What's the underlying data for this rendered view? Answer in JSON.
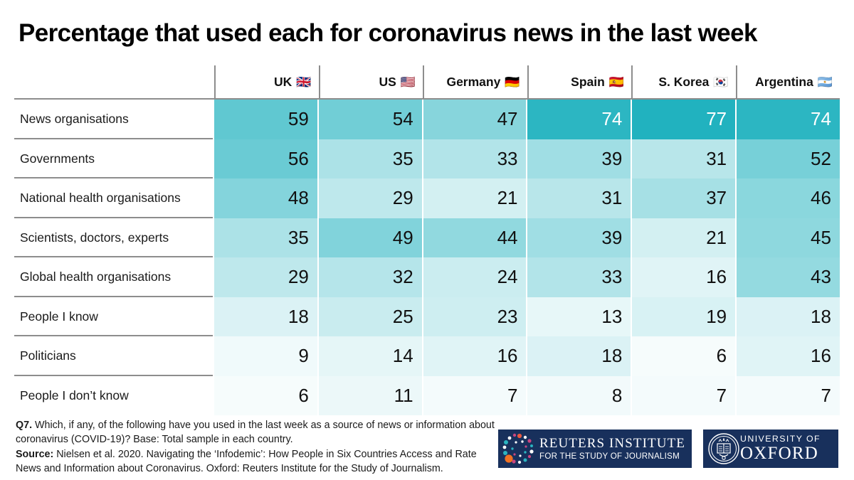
{
  "title": "Percentage that used each for coronavirus news in the last week",
  "colors": {
    "teal_max": "#21b2bf",
    "teal_light": "#f9fdfd",
    "rule": "#8d8d8d",
    "logo_navy": "#18305c"
  },
  "table": {
    "row_header_label": "",
    "columns": [
      {
        "label": "UK",
        "flag": "🇬🇧",
        "flag_name": "flag-uk"
      },
      {
        "label": "US",
        "flag": "🇺🇸",
        "flag_name": "flag-us"
      },
      {
        "label": "Germany",
        "flag": "🇩🇪",
        "flag_name": "flag-germany"
      },
      {
        "label": "Spain",
        "flag": "🇪🇸",
        "flag_name": "flag-spain"
      },
      {
        "label": "S. Korea",
        "flag": "🇰🇷",
        "flag_name": "flag-south-korea"
      },
      {
        "label": "Argentina",
        "flag": "🇦🇷",
        "flag_name": "flag-argentina"
      }
    ],
    "rows": [
      {
        "label": "News organisations",
        "values": [
          59,
          54,
          47,
          74,
          77,
          74
        ]
      },
      {
        "label": "Governments",
        "values": [
          56,
          35,
          33,
          39,
          31,
          52
        ]
      },
      {
        "label": "National health organisations",
        "values": [
          48,
          29,
          21,
          31,
          37,
          46
        ]
      },
      {
        "label": "Scientists, doctors, experts",
        "values": [
          35,
          49,
          44,
          39,
          21,
          45
        ]
      },
      {
        "label": "Global health organisations",
        "values": [
          29,
          32,
          24,
          33,
          16,
          43
        ]
      },
      {
        "label": "People I know",
        "values": [
          18,
          25,
          23,
          13,
          19,
          18
        ]
      },
      {
        "label": "Politicians",
        "values": [
          9,
          14,
          16,
          18,
          6,
          16
        ]
      },
      {
        "label": "People I don’t know",
        "values": [
          6,
          11,
          7,
          8,
          7,
          7
        ]
      }
    ]
  },
  "chart_data": {
    "type": "heatmap",
    "title": "Percentage that used each for coronavirus news in the last week",
    "xlabel": "",
    "ylabel": "",
    "categories": [
      "UK",
      "US",
      "Germany",
      "Spain",
      "S. Korea",
      "Argentina"
    ],
    "rows": [
      "News organisations",
      "Governments",
      "National health organisations",
      "Scientists, doctors, experts",
      "Global health organisations",
      "People I know",
      "Politicians",
      "People I don’t know"
    ],
    "values": [
      [
        59,
        54,
        47,
        74,
        77,
        74
      ],
      [
        56,
        35,
        33,
        39,
        31,
        52
      ],
      [
        48,
        29,
        21,
        31,
        37,
        46
      ],
      [
        35,
        49,
        44,
        39,
        21,
        45
      ],
      [
        29,
        32,
        24,
        33,
        16,
        43
      ],
      [
        18,
        25,
        23,
        13,
        19,
        18
      ],
      [
        9,
        14,
        16,
        18,
        6,
        16
      ],
      [
        6,
        11,
        7,
        8,
        7,
        7
      ]
    ],
    "unit": "percent",
    "value_range": [
      6,
      77
    ],
    "colorscale": "white-to-teal",
    "grid": false,
    "legend": "none"
  },
  "footnote": {
    "q_label": "Q7.",
    "q_text": " Which, if any, of the following have you used in the last week as a source of news or information about coronavirus (COVID-19)? Base: Total sample in each country.",
    "source_label": "Source:",
    "source_text": " Nielsen et al. 2020. Navigating the ‘Infodemic’: How People in Six Countries Access and Rate News and Information about Coronavirus. Oxford: Reuters Institute for the Study of Journalism."
  },
  "logos": {
    "reuters": {
      "line1": "REUTERS INSTITUTE",
      "line2": "FOR THE STUDY OF JOURNALISM"
    },
    "oxford": {
      "line1": "UNIVERSITY OF",
      "line2": "OXFORD"
    }
  }
}
